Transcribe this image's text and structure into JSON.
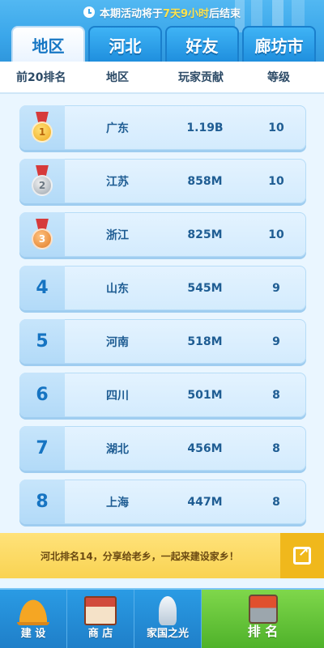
{
  "notice": {
    "prefix": "本期活动将于",
    "highlight": "7天9小时",
    "suffix": "后结束"
  },
  "tabs": [
    {
      "label": "地区",
      "active": true
    },
    {
      "label": "河北",
      "active": false
    },
    {
      "label": "好友",
      "active": false
    },
    {
      "label": "廊坊市",
      "active": false
    }
  ],
  "columns": {
    "rank": "前20排名",
    "region": "地区",
    "score": "玩家贡献",
    "level": "等级"
  },
  "rows": [
    {
      "rank": "1",
      "medal": "gold",
      "region": "广东",
      "score": "1.19B",
      "level": "10"
    },
    {
      "rank": "2",
      "medal": "silver",
      "region": "江苏",
      "score": "858M",
      "level": "10"
    },
    {
      "rank": "3",
      "medal": "bronze",
      "region": "浙江",
      "score": "825M",
      "level": "10"
    },
    {
      "rank": "4",
      "medal": "",
      "region": "山东",
      "score": "545M",
      "level": "9"
    },
    {
      "rank": "5",
      "medal": "",
      "region": "河南",
      "score": "518M",
      "level": "9"
    },
    {
      "rank": "6",
      "medal": "",
      "region": "四川",
      "score": "501M",
      "level": "8"
    },
    {
      "rank": "7",
      "medal": "",
      "region": "湖北",
      "score": "456M",
      "level": "8"
    },
    {
      "rank": "8",
      "medal": "",
      "region": "上海",
      "score": "447M",
      "level": "8"
    }
  ],
  "share": {
    "text": "河北排名14，分享给老乡，一起来建设家乡！"
  },
  "nav": [
    {
      "label": "建 设",
      "icon": "helmet-icon"
    },
    {
      "label": "商 店",
      "icon": "shop-icon"
    },
    {
      "label": "家国之光",
      "icon": "rocket-icon"
    },
    {
      "label": "排 名",
      "icon": "ranking-icon",
      "active": true
    }
  ],
  "colors": {
    "accent": "#1777c4",
    "highlight": "#ffe34d",
    "share_bg": "#f9d352",
    "nav_active": "#4fb22a"
  }
}
